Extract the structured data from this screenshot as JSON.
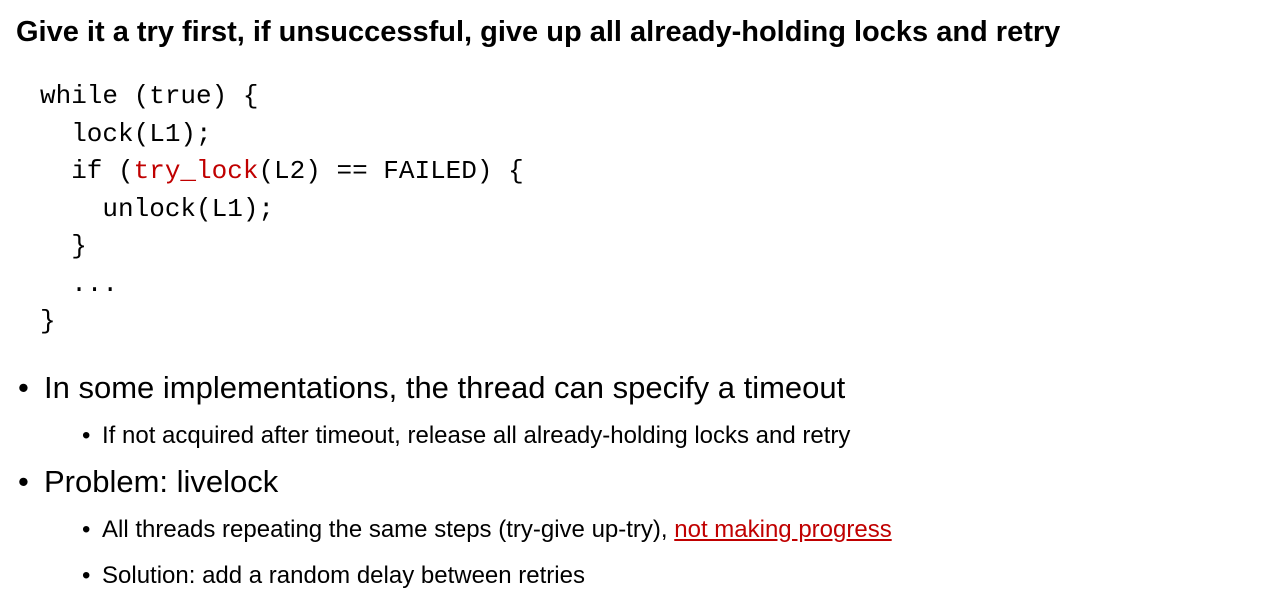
{
  "heading": "Give it a try first, if unsuccessful, give up all already-holding locks and retry",
  "code": {
    "line1": "while (true) {",
    "line2": "  lock(L1);",
    "line3_pre": "  if (",
    "line3_hl": "try_lock",
    "line3_post": "(L2) == FAILED) {",
    "line4": "    unlock(L1);",
    "line5": "  }",
    "line6": "  ...",
    "line7": "}",
    "highlight_color": "#C00000"
  },
  "bullets": {
    "b1": "In some implementations, the thread can specify a timeout",
    "b1_sub1": "If not acquired after timeout, release all already-holding locks and retry",
    "b2": "Problem: livelock",
    "b2_sub1_pre": "All threads repeating the same steps (try-give up-try), ",
    "b2_sub1_link": "not making progress",
    "b2_sub2": "Solution: add a random delay between retries",
    "bullet_glyph": "•"
  }
}
